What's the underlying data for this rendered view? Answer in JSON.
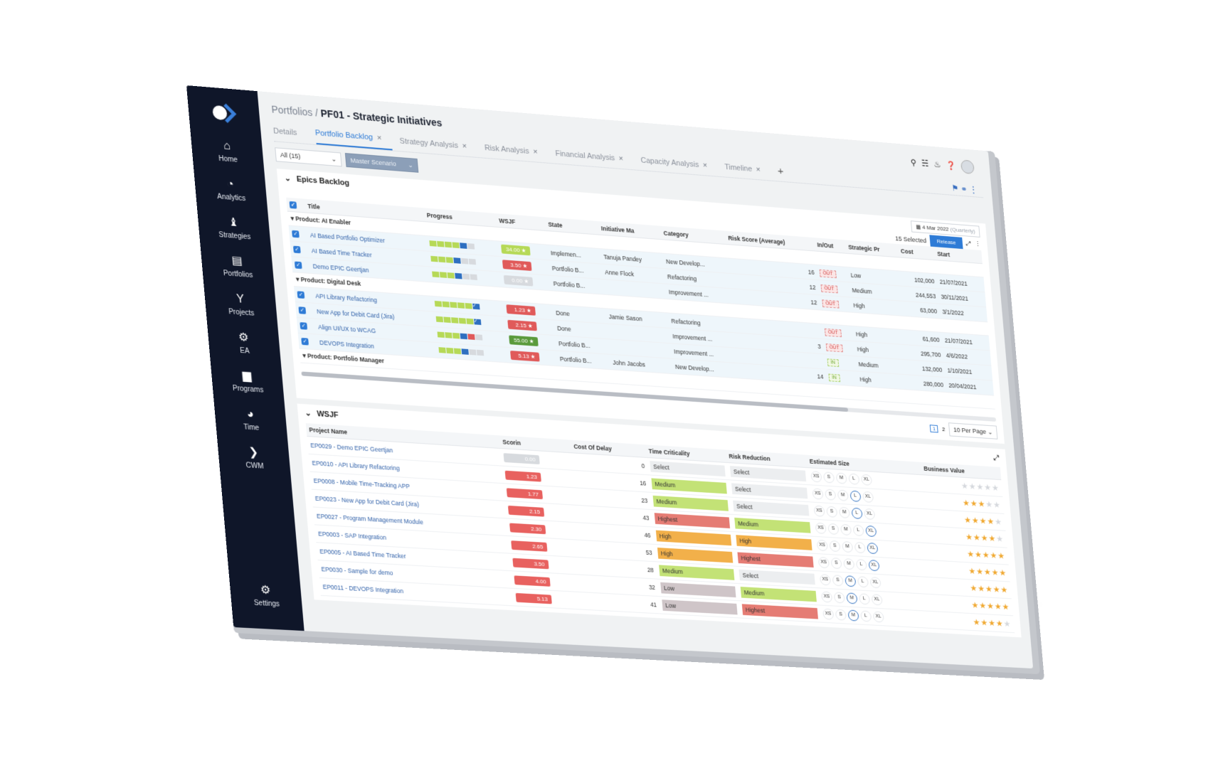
{
  "sidebar": {
    "logo": "app-logo",
    "items": [
      {
        "label": "Home",
        "icon": "home-icon",
        "glyph": "⌂"
      },
      {
        "label": "Analytics",
        "icon": "analytics-icon",
        "glyph": "◔"
      },
      {
        "label": "Strategies",
        "icon": "chess-icon",
        "glyph": "♝"
      },
      {
        "label": "Portfolios",
        "icon": "portfolio-icon",
        "glyph": "▤"
      },
      {
        "label": "Projects",
        "icon": "projects-icon",
        "glyph": "Y"
      },
      {
        "label": "EA",
        "icon": "gears-icon",
        "glyph": "⚙"
      },
      {
        "label": "Programs",
        "icon": "folder-icon",
        "glyph": "▆"
      },
      {
        "label": "Time",
        "icon": "stopwatch-icon",
        "glyph": "◕"
      },
      {
        "label": "CWM",
        "icon": "cwm-icon",
        "glyph": "❯"
      }
    ],
    "settings": {
      "label": "Settings",
      "glyph": "⚙"
    }
  },
  "header": {
    "breadcrumb_parent": "Portfolios",
    "separator": "/",
    "title": "PF01 - Strategic Initiatives"
  },
  "tabs": [
    {
      "label": "Details",
      "closable": false
    },
    {
      "label": "Portfolio Backlog",
      "closable": true,
      "active": true
    },
    {
      "label": "Strategy Analysis",
      "closable": true
    },
    {
      "label": "Risk Analysis",
      "closable": true
    },
    {
      "label": "Financial Analysis",
      "closable": true
    },
    {
      "label": "Capacity Analysis",
      "closable": true
    },
    {
      "label": "Timeline",
      "closable": true
    }
  ],
  "tab_close": "×",
  "tab_add": "+",
  "filters": {
    "scope": "All (15)",
    "scenario": "Master Scenario"
  },
  "epics": {
    "title": "Epics Backlog",
    "date": "4 Mar 2022",
    "date_mode": "(Quarterly)",
    "selected": "15 Selected",
    "release": "Release",
    "columns": [
      "Title",
      "Progress",
      "WSJF",
      "State",
      "Initiative Ma",
      "Category",
      "Risk Score (Average)",
      "In/Out",
      "Strategic Pr",
      "Cost",
      "Start"
    ],
    "groups": [
      {
        "name": "Product: AI Enabler",
        "rows": [
          {
            "title": "AI Based Portfolio Optimizer",
            "progress": "ggggbe",
            "wsjf": "34.00 ★",
            "wsjf_color": "#b6d957",
            "state": "Implemen...",
            "manager": "Tanuja Pandey",
            "category": "New Develop...",
            "risk": "16",
            "inout": "OUT",
            "priority": "Low",
            "cost": "102,000",
            "start": "21/07/2021"
          },
          {
            "title": "AI Based Time Tracker",
            "progress": "gggbee",
            "wsjf": "3.50 ★",
            "wsjf_color": "#e05a5a",
            "state": "Portfolio B...",
            "manager": "Anne Flock",
            "category": "Refactoring",
            "risk": "12",
            "inout": "OUT",
            "priority": "Medium",
            "cost": "244,553",
            "start": "30/11/2021"
          },
          {
            "title": "Demo EPIC Geertjan",
            "progress": "gggbee",
            "wsjf": "0.00 ★",
            "wsjf_color": "#d7dade",
            "state": "Portfolio B...",
            "manager": "",
            "category": "Improvement ...",
            "risk": "12",
            "inout": "OUT",
            "priority": "High",
            "cost": "63,000",
            "start": "3/1/2022"
          }
        ]
      },
      {
        "name": "Product: Digital Desk",
        "rows": [
          {
            "title": "API Library Refactoring",
            "progress": "gggggc",
            "wsjf": "1.23 ★",
            "wsjf_color": "#e05a5a",
            "state": "Done",
            "manager": "Jamie Sason",
            "category": "Refactoring",
            "risk": "",
            "inout": "OUT",
            "priority": "High",
            "cost": "61,600",
            "start": "21/07/2021"
          },
          {
            "title": "New App for Debit Card (Jira)",
            "progress": "gggggc",
            "wsjf": "2.15 ★",
            "wsjf_color": "#e05a5a",
            "state": "Done",
            "manager": "",
            "category": "Improvement ...",
            "risk": "3",
            "inout": "OUT",
            "priority": "High",
            "cost": "295,700",
            "start": "4/6/2022"
          },
          {
            "title": "Align UI/UX to WCAG",
            "progress": "gggbre",
            "wsjf": "55.00 ★",
            "wsjf_color": "#5a9a3c",
            "state": "Portfolio B...",
            "manager": "",
            "category": "Improvement ...",
            "risk": "",
            "inout": "IN",
            "priority": "Medium",
            "cost": "132,000",
            "start": "1/10/2021"
          },
          {
            "title": "DEVOPS Integration",
            "progress": "gggbee",
            "wsjf": "5.13 ★",
            "wsjf_color": "#e05a5a",
            "state": "Portfolio B...",
            "manager": "John Jacobs",
            "category": "New Develop...",
            "risk": "14",
            "inout": "IN",
            "priority": "High",
            "cost": "280,000",
            "start": "20/04/2021"
          }
        ]
      },
      {
        "name": "Product: Portfolio Manager",
        "rows": []
      }
    ],
    "pagination": {
      "current": "1",
      "next": "2",
      "per_page": "10 Per Page"
    }
  },
  "wsjf": {
    "title": "WSJF",
    "columns": [
      "Project Name",
      "Scorin",
      "Cost Of Delay",
      "Time Criticality",
      "Risk Reduction",
      "Estimated Size",
      "Business Value"
    ],
    "sort_indicator": "1",
    "sizes": [
      "XS",
      "S",
      "M",
      "L",
      "XL"
    ],
    "rows": [
      {
        "name": "EP0029 - Demo EPIC Geertjan",
        "score": "0.00",
        "score_color": "#d7dade",
        "cod": "0",
        "tc": "Select",
        "rr": "Select",
        "size": "",
        "stars": 0
      },
      {
        "name": "EP0010 - API Library Refactoring",
        "score": "1.23",
        "score_color": "#e8615f",
        "cod": "16",
        "tc": "Medium",
        "rr": "Select",
        "size": "L",
        "stars": 3
      },
      {
        "name": "EP0008 - Mobile Time-Tracking APP",
        "score": "1.77",
        "score_color": "#e8615f",
        "cod": "23",
        "tc": "Medium",
        "rr": "Select",
        "size": "L",
        "stars": 4
      },
      {
        "name": "EP0023 - New App for Debit Card (Jira)",
        "score": "2.15",
        "score_color": "#e8615f",
        "cod": "43",
        "tc": "Highest",
        "rr": "Medium",
        "size": "XL",
        "stars": 4
      },
      {
        "name": "EP0027 - Program Management Module",
        "score": "2.30",
        "score_color": "#e8615f",
        "cod": "46",
        "tc": "High",
        "rr": "High",
        "size": "XL",
        "stars": 5
      },
      {
        "name": "EP0003 - SAP Integration",
        "score": "2.65",
        "score_color": "#e8615f",
        "cod": "53",
        "tc": "High",
        "rr": "Highest",
        "size": "XL",
        "stars": 5
      },
      {
        "name": "EP0005 - AI Based Time Tracker",
        "score": "3.50",
        "score_color": "#e8615f",
        "cod": "28",
        "tc": "Medium",
        "rr": "Select",
        "size": "M",
        "stars": 5
      },
      {
        "name": "EP0030 - Sample for demo",
        "score": "4.00",
        "score_color": "#e8615f",
        "cod": "32",
        "tc": "Low",
        "rr": "Medium",
        "size": "M",
        "stars": 5
      },
      {
        "name": "EP0011 - DEVOPS Integration",
        "score": "5.13",
        "score_color": "#e8615f",
        "cod": "41",
        "tc": "Low",
        "rr": "Highest",
        "size": "M",
        "stars": 4
      }
    ],
    "level_colors": {
      "Select": "#eceef0",
      "Low": "#cfc5c8",
      "Medium": "#c3e276",
      "High": "#f2b04a",
      "Highest": "#e57c74"
    }
  },
  "colors": {
    "accent": "#2e7bd6",
    "sidebar": "#0f1629"
  }
}
